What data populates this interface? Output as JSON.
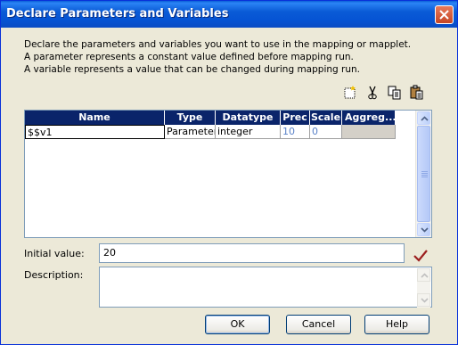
{
  "window": {
    "title": "Declare Parameters and Variables"
  },
  "description": [
    "Declare the parameters and variables you want to use in the mapping or mapplet.",
    "A parameter represents a constant value defined before mapping run.",
    "A variable represents a value that can be changed during mapping run."
  ],
  "toolbar": [
    "new-icon",
    "cut-icon",
    "copy-icon",
    "paste-icon"
  ],
  "grid": {
    "columns": [
      "Name",
      "Type",
      "Datatype",
      "Prec",
      "Scale",
      "Aggreg..."
    ],
    "rows": [
      {
        "name": "$$v1",
        "type": "Parameter",
        "datatype": "integer",
        "prec": "10",
        "scale": "0",
        "aggregation": ""
      }
    ]
  },
  "initial_value": {
    "label": "Initial value:",
    "value": "20"
  },
  "description_field": {
    "label": "Description:",
    "value": ""
  },
  "buttons": {
    "ok": "OK",
    "cancel": "Cancel",
    "help": "Help"
  },
  "colors": {
    "titlebar": "#0a5bd6",
    "grid_header": "#0a246a",
    "check": "#9c1f1f"
  }
}
